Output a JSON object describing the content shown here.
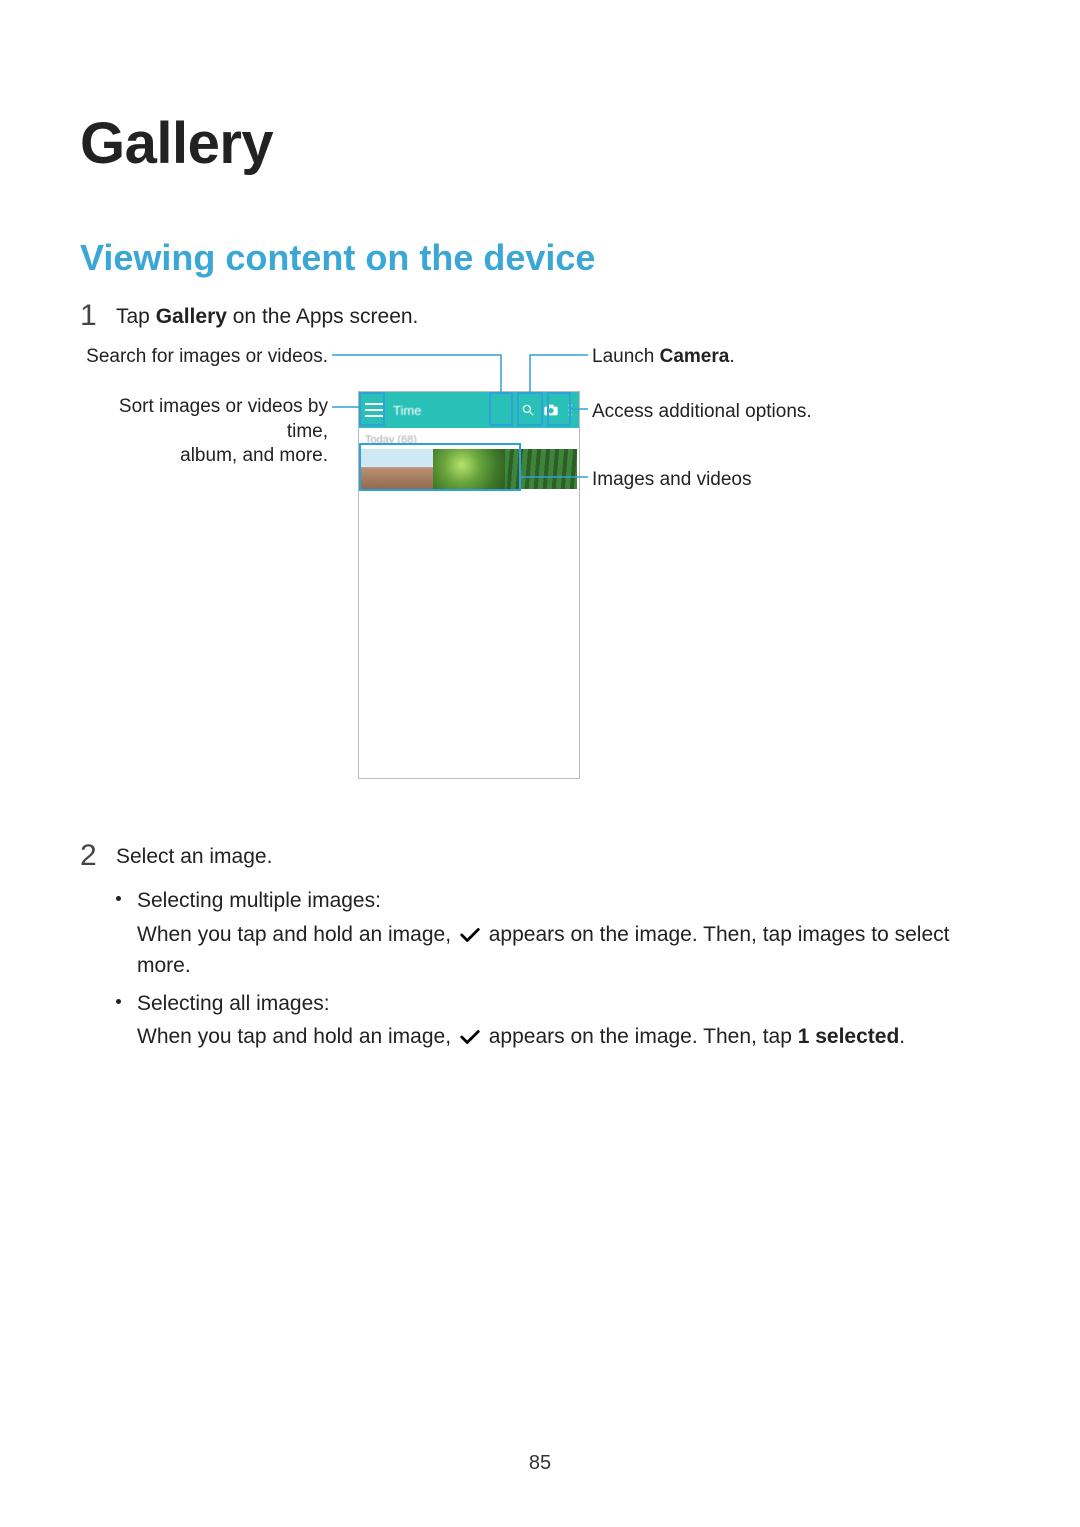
{
  "title": "Gallery",
  "section": "Viewing content on the device",
  "step1": {
    "num": "1",
    "pre": "Tap ",
    "bold": "Gallery",
    "post": " on the Apps screen."
  },
  "callouts": {
    "search": "Search for images or videos.",
    "sort_l1": "Sort images or videos by time,",
    "sort_l2": "album, and more.",
    "camera_pre": "Launch ",
    "camera_bold": "Camera",
    "camera_post": ".",
    "options": "Access additional options.",
    "imgvid": "Images and videos"
  },
  "phone": {
    "sort_label": "Time",
    "date_label": "Today (68)"
  },
  "step2": {
    "num": "2",
    "text": "Select an image."
  },
  "bullet1": {
    "head": "Selecting multiple images:",
    "body_pre": "When you tap and hold an image, ",
    "body_post": " appears on the image. Then, tap images to select more."
  },
  "bullet2": {
    "head": "Selecting all images:",
    "body_pre": "When you tap and hold an image, ",
    "body_mid": " appears on the image. Then, tap ",
    "body_bold": "1 selected",
    "body_post": "."
  },
  "page_number": "85"
}
